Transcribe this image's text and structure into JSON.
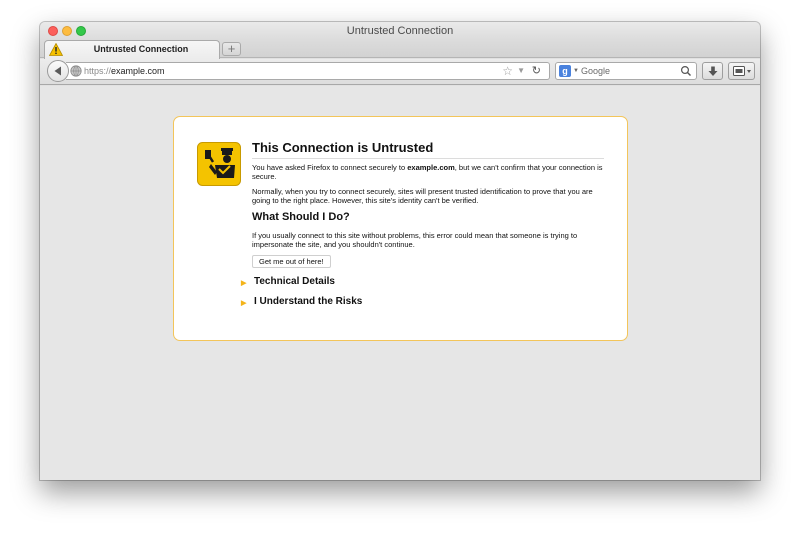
{
  "window": {
    "title": "Untrusted Connection"
  },
  "tab": {
    "title": "Untrusted Connection",
    "new_tab_label": "+"
  },
  "navbar": {
    "url_scheme": "https://",
    "url_host": "example.com",
    "search_placeholder": "Google",
    "search_engine_letter": "g"
  },
  "error": {
    "title": "This Connection is Untrusted",
    "p1_before": "You have asked Firefox to connect securely to ",
    "p1_domain": "example.com",
    "p1_after": ", but we can't confirm that your connection is secure.",
    "p2": "Normally, when you try to connect securely, sites will present trusted identification to prove that you are going to the right place. However, this site's identity can't be verified.",
    "subhead": "What Should I Do?",
    "p3": "If you usually connect to this site without problems, this error could mean that someone is trying to impersonate the site, and you shouldn't continue.",
    "button_label": "Get me out of here!",
    "expander_technical": "Technical Details",
    "expander_risks": "I Understand the Risks"
  },
  "colors": {
    "accent_border": "#f3c55a",
    "warning_yellow": "#f4b41a",
    "close": "#fc605c",
    "minimize": "#fdbc40",
    "maximize": "#34c84a"
  },
  "icons": [
    "warning-icon",
    "back-arrow-icon",
    "globe-icon",
    "star-icon",
    "dropdown-icon",
    "reload-icon",
    "google-icon",
    "search-icon",
    "download-icon",
    "menu-icon",
    "policeman-icon",
    "expand-arrow-icon"
  ]
}
